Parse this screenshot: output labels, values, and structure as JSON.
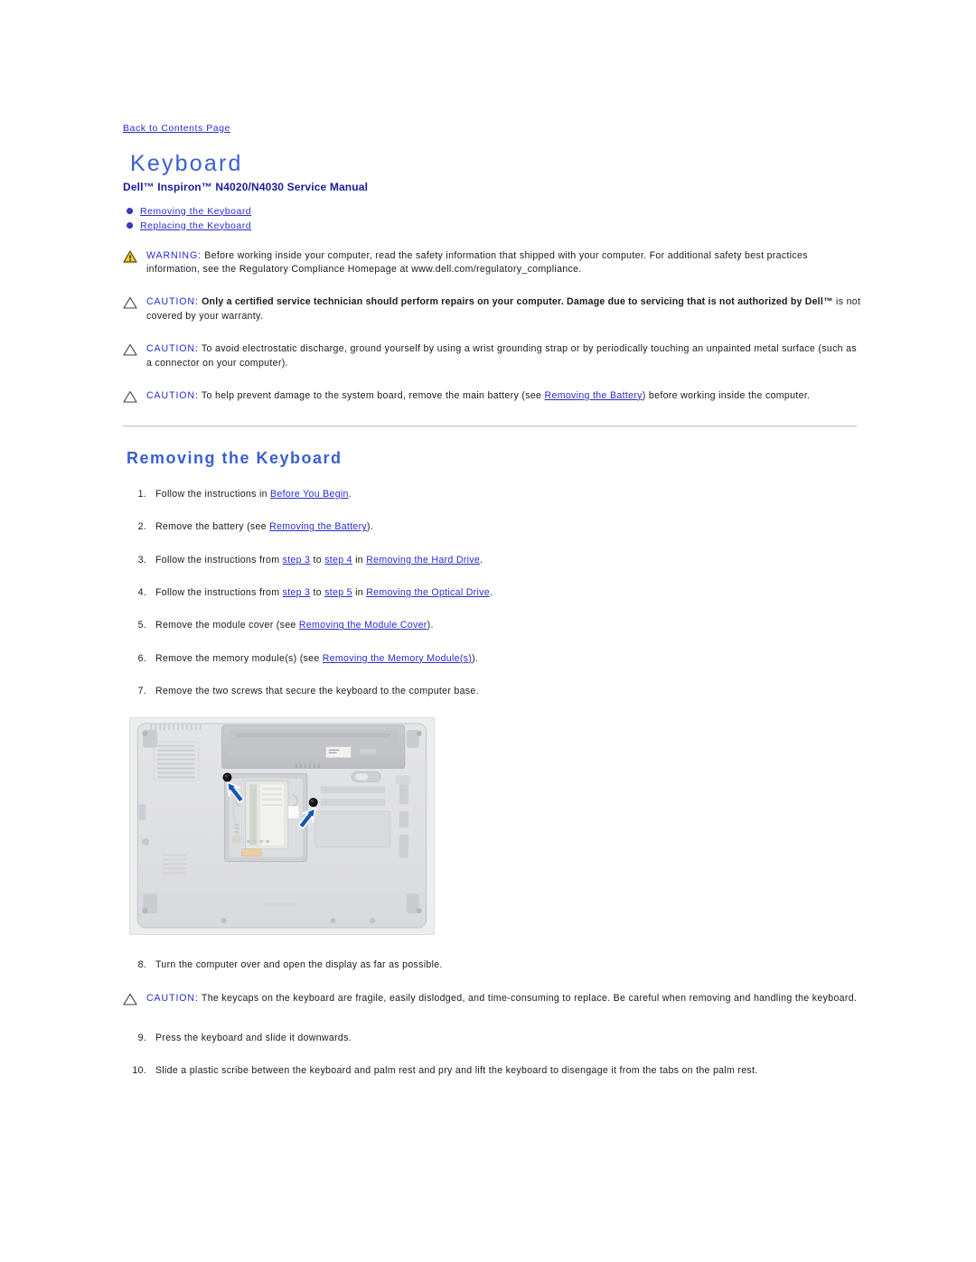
{
  "nav": {
    "back_link": "Back to Contents Page"
  },
  "header": {
    "title": "Keyboard",
    "subtitle": "Dell™ Inspiron™ N4020/N4030 Service Manual"
  },
  "toc": {
    "items": [
      {
        "label": "Removing the Keyboard"
      },
      {
        "label": "Replacing the Keyboard"
      }
    ]
  },
  "admonitions": [
    {
      "type": "warning",
      "icon": "warning-triangle-icon",
      "label": "WARNING:",
      "text_before": " Before working inside your computer, read the safety information that shipped with your computer. For additional safety best practices information, see the Regulatory Compliance Homepage at www.dell.com/regulatory_compliance.",
      "bold_text": "",
      "text_after": ""
    },
    {
      "type": "caution",
      "icon": "caution-triangle-icon",
      "label": "CAUTION:",
      "text_before": " ",
      "bold_text": "Only a certified service technician should perform repairs on your computer. Damage due to servicing that is not authorized by Dell™",
      "text_after": " is not covered by your warranty."
    },
    {
      "type": "caution",
      "icon": "caution-triangle-icon",
      "label": "CAUTION:",
      "text_before": " To avoid electrostatic discharge, ground yourself by using a wrist grounding strap or by periodically touching an unpainted metal surface (such as a connector on your computer).",
      "bold_text": "",
      "text_after": ""
    },
    {
      "type": "caution",
      "icon": "caution-triangle-icon",
      "label": "CAUTION:",
      "text_before": " To help prevent damage to the system board, remove the main battery (see ",
      "link_text": "Removing the Battery",
      "text_after": ") before working inside the computer."
    }
  ],
  "section": {
    "heading": "Removing the Keyboard"
  },
  "steps": [
    {
      "num": "1.",
      "parts": [
        {
          "t": "Follow the instructions in "
        },
        {
          "t": "Before You Begin",
          "link": true
        },
        {
          "t": "."
        }
      ]
    },
    {
      "num": "2.",
      "parts": [
        {
          "t": "Remove the battery (see "
        },
        {
          "t": "Removing the Battery",
          "link": true
        },
        {
          "t": ")."
        }
      ]
    },
    {
      "num": "3.",
      "parts": [
        {
          "t": "Follow the instructions from "
        },
        {
          "t": "step 3",
          "link": true
        },
        {
          "t": " to "
        },
        {
          "t": "step 4",
          "link": true
        },
        {
          "t": " in "
        },
        {
          "t": "Removing the Hard Drive",
          "link": true
        },
        {
          "t": "."
        }
      ]
    },
    {
      "num": "4.",
      "parts": [
        {
          "t": "Follow the instructions from "
        },
        {
          "t": "step 3",
          "link": true
        },
        {
          "t": " to "
        },
        {
          "t": "step 5",
          "link": true
        },
        {
          "t": " in "
        },
        {
          "t": "Removing the Optical Drive",
          "link": true
        },
        {
          "t": "."
        }
      ]
    },
    {
      "num": "5.",
      "parts": [
        {
          "t": "Remove the module cover (see "
        },
        {
          "t": "Removing the Module Cover",
          "link": true
        },
        {
          "t": ")."
        }
      ]
    },
    {
      "num": "6.",
      "parts": [
        {
          "t": "Remove the memory module(s) (see "
        },
        {
          "t": "Removing the Memory Module(s)",
          "link": true
        },
        {
          "t": ")."
        }
      ]
    },
    {
      "num": "7.",
      "parts": [
        {
          "t": "Remove the two screws that secure the keyboard to the computer base."
        }
      ]
    }
  ],
  "figure": {
    "alt": "Bottom view of laptop base showing module cover area with two screws indicated by arrows",
    "callouts": [
      {
        "name": "screw-callout-1"
      },
      {
        "name": "screw-callout-2"
      }
    ]
  },
  "steps_after": [
    {
      "num": "8.",
      "parts": [
        {
          "t": "Turn the computer over and open the display as far as possible."
        }
      ]
    }
  ],
  "caution_keycaps": {
    "type": "caution",
    "icon": "caution-triangle-icon",
    "label": "CAUTION:",
    "text": " The keycaps on the keyboard are fragile, easily dislodged, and time-consuming to replace. Be careful when removing and handling the keyboard."
  },
  "steps_final": [
    {
      "num": "9.",
      "parts": [
        {
          "t": "Press the keyboard and slide it downwards."
        }
      ]
    },
    {
      "num": "10.",
      "parts": [
        {
          "t": "Slide a plastic scribe between the keyboard and palm rest and pry and lift the keyboard to disengage it from the tabs on the palm rest."
        }
      ]
    }
  ],
  "colors": {
    "link": "#2b2bd0",
    "title": "#3a5fd0",
    "subtitle": "#1b1b9e",
    "warning_icon_fill": "#f5d016",
    "arrow_blue": "#1558b0",
    "rule": "#c9c9c9"
  }
}
